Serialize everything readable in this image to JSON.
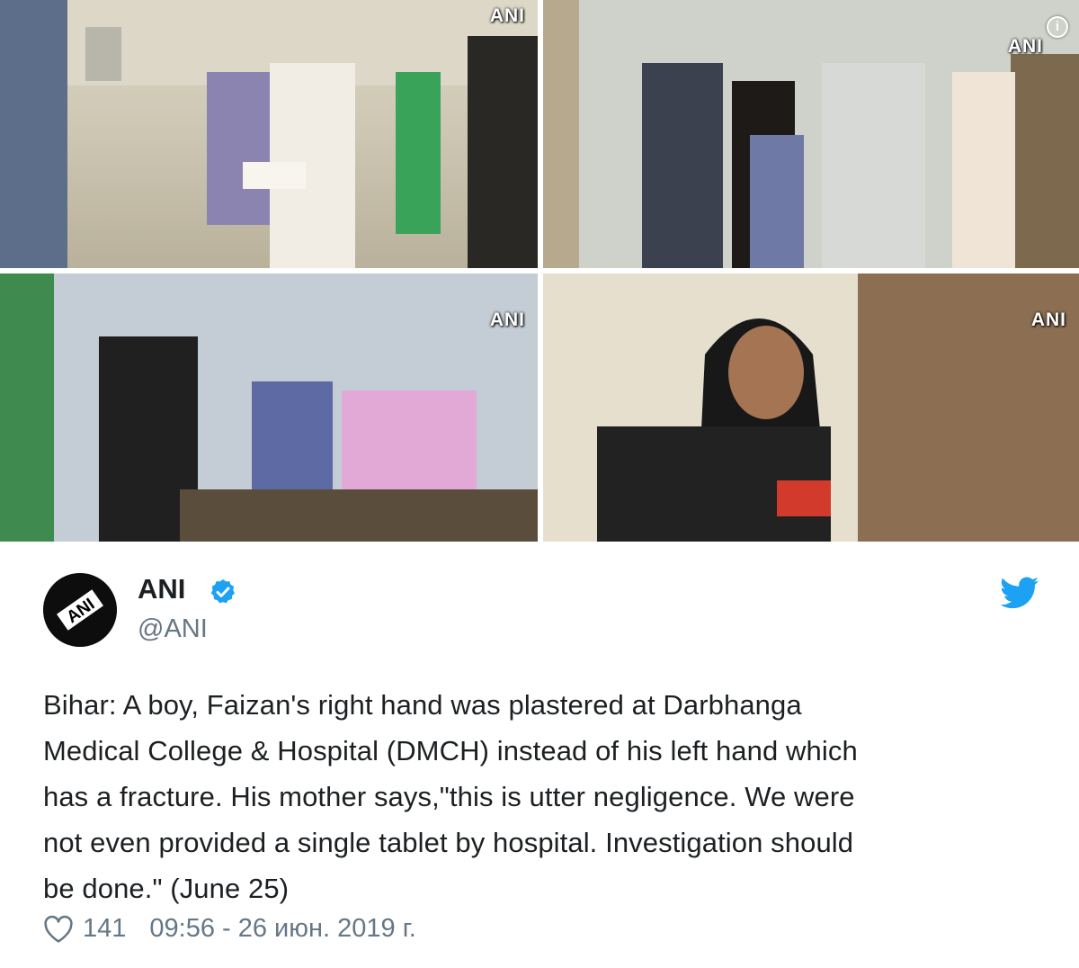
{
  "media": {
    "watermarks": [
      "ANI",
      "ANI",
      "ANI",
      "ANI"
    ],
    "info_glyph": "i"
  },
  "tweet": {
    "author_name": "ANI",
    "handle": "@ANI",
    "verified": true,
    "text_lines": [
      "Bihar: A boy, Faizan's right hand was plastered at Darbhanga",
      "Medical College & Hospital (DMCH) instead of his left hand which",
      "has a fracture. His mother says,\"this is utter negligence. We were",
      "not even provided a single tablet by hospital. Investigation should",
      "be done.\" (June 25)"
    ],
    "likes": "141",
    "timestamp": "09:56 - 26 июн. 2019 г."
  },
  "colors": {
    "twitter_blue": "#1da1f2",
    "text": "#1c2022",
    "secondary": "#657786"
  },
  "icons": {
    "verified": "verified-badge-icon",
    "brand": "twitter-bird-icon",
    "like": "heart-icon",
    "info": "info-icon"
  }
}
